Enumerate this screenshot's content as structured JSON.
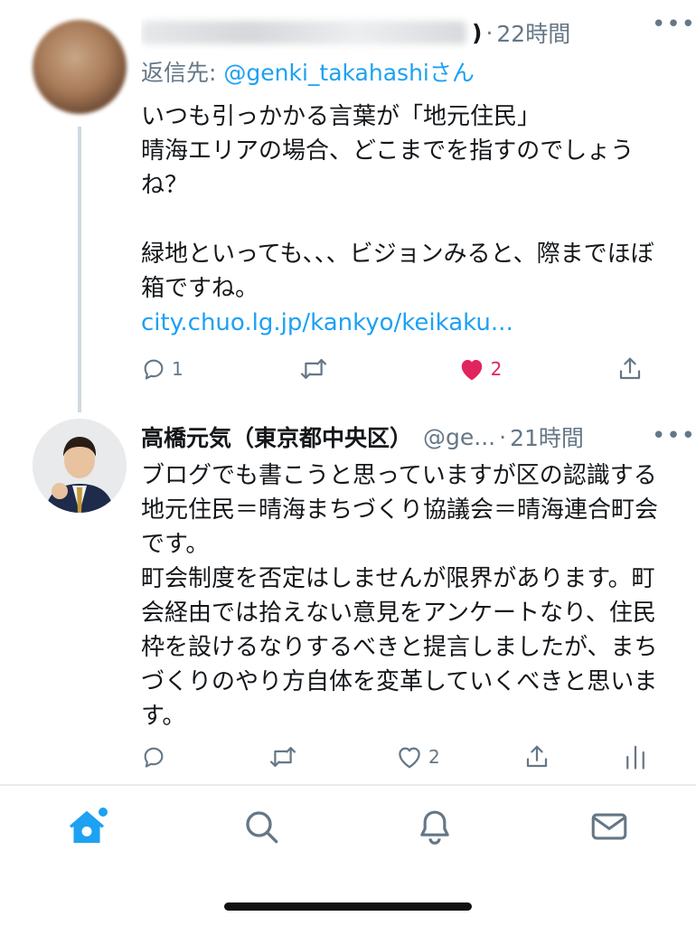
{
  "tweet1": {
    "name_tail": ")",
    "time": "22時間",
    "more": "•••",
    "reply_prefix": "返信先: ",
    "reply_handle": "@genki_takahashi",
    "reply_suffix": "さん",
    "text": "いつも引っかかる言葉が「地元住民」\n晴海エリアの場合、どこまでを指すのでしょうね？\n\n緑地といっても、、、ビジョンみると、際までほぼ箱ですね。",
    "link": "city.chuo.lg.jp/kankyo/keikaku...",
    "actions": {
      "replies": "1",
      "retweets": "",
      "likes": "2",
      "liked": true
    }
  },
  "tweet2": {
    "name": "高橋元気（東京都中央区）",
    "handle": "@ge...",
    "time": "21時間",
    "more": "•••",
    "text": "ブログでも書こうと思っていますが区の認識する地元住民＝晴海まちづくり協議会＝晴海連合町会です。\n町会制度を否定はしませんが限界があります。町会経由では拾えない意見をアンケートなり、住民枠を設けるなりするべきと提言しましたが、まちづくりのやり方自体を変革していくべきと思います。",
    "actions": {
      "replies": "",
      "retweets": "",
      "likes": "2"
    }
  },
  "tabbar": {
    "items": [
      {
        "icon": "home-icon",
        "active": true,
        "has_dot": true
      },
      {
        "icon": "search-icon",
        "active": false
      },
      {
        "icon": "bell-icon",
        "active": false
      },
      {
        "icon": "mail-icon",
        "active": false
      }
    ]
  },
  "colors": {
    "accent": "#1da1f2",
    "like": "#e0245e",
    "secondary_text": "#657786",
    "primary_text": "#14171a"
  }
}
